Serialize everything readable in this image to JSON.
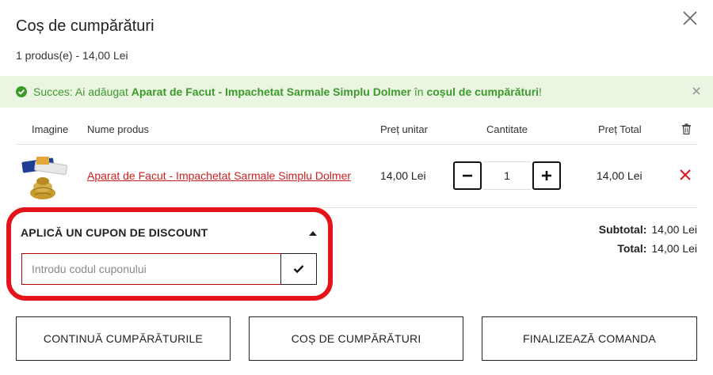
{
  "cart": {
    "title": "Coș de cumpărături",
    "summary": "1 produs(e) - 14,00 Lei"
  },
  "alert": {
    "prefix": "Succes: Ai adăugat ",
    "product": "Aparat de Facut - Impachetat Sarmale Simplu Dolmer",
    "middle": " în ",
    "link": "coșul de cumpărături",
    "suffix": "!"
  },
  "table": {
    "headers": {
      "image": "Imagine",
      "name": "Nume produs",
      "unit_price": "Preț unitar",
      "quantity": "Cantitate",
      "total_price": "Preț Total"
    },
    "rows": [
      {
        "name": "Aparat de Facut - Impachetat Sarmale Simplu Dolmer",
        "unit_price": "14,00 Lei",
        "quantity": "1",
        "total_price": "14,00 Lei"
      }
    ]
  },
  "coupon": {
    "title": "APLICĂ UN CUPON DE DISCOUNT",
    "placeholder": "Introdu codul cuponului"
  },
  "totals": {
    "subtotal_label": "Subtotal:",
    "subtotal_value": "14,00 Lei",
    "total_label": "Total:",
    "total_value": "14,00 Lei"
  },
  "actions": {
    "continue": "CONTINUĂ CUMPĂRĂTURILE",
    "cart": "COȘ DE CUMPĂRĂTURI",
    "checkout": "FINALIZEAZĂ COMANDA"
  },
  "colors": {
    "accent_red": "#e4141a",
    "success_green": "#3c9a2c",
    "success_bg": "#eaf6e2"
  },
  "icons": [
    "close-icon",
    "check-circle-icon",
    "trash-icon",
    "minus-icon",
    "plus-icon",
    "remove-icon",
    "caret-up-icon",
    "checkmark-icon"
  ]
}
